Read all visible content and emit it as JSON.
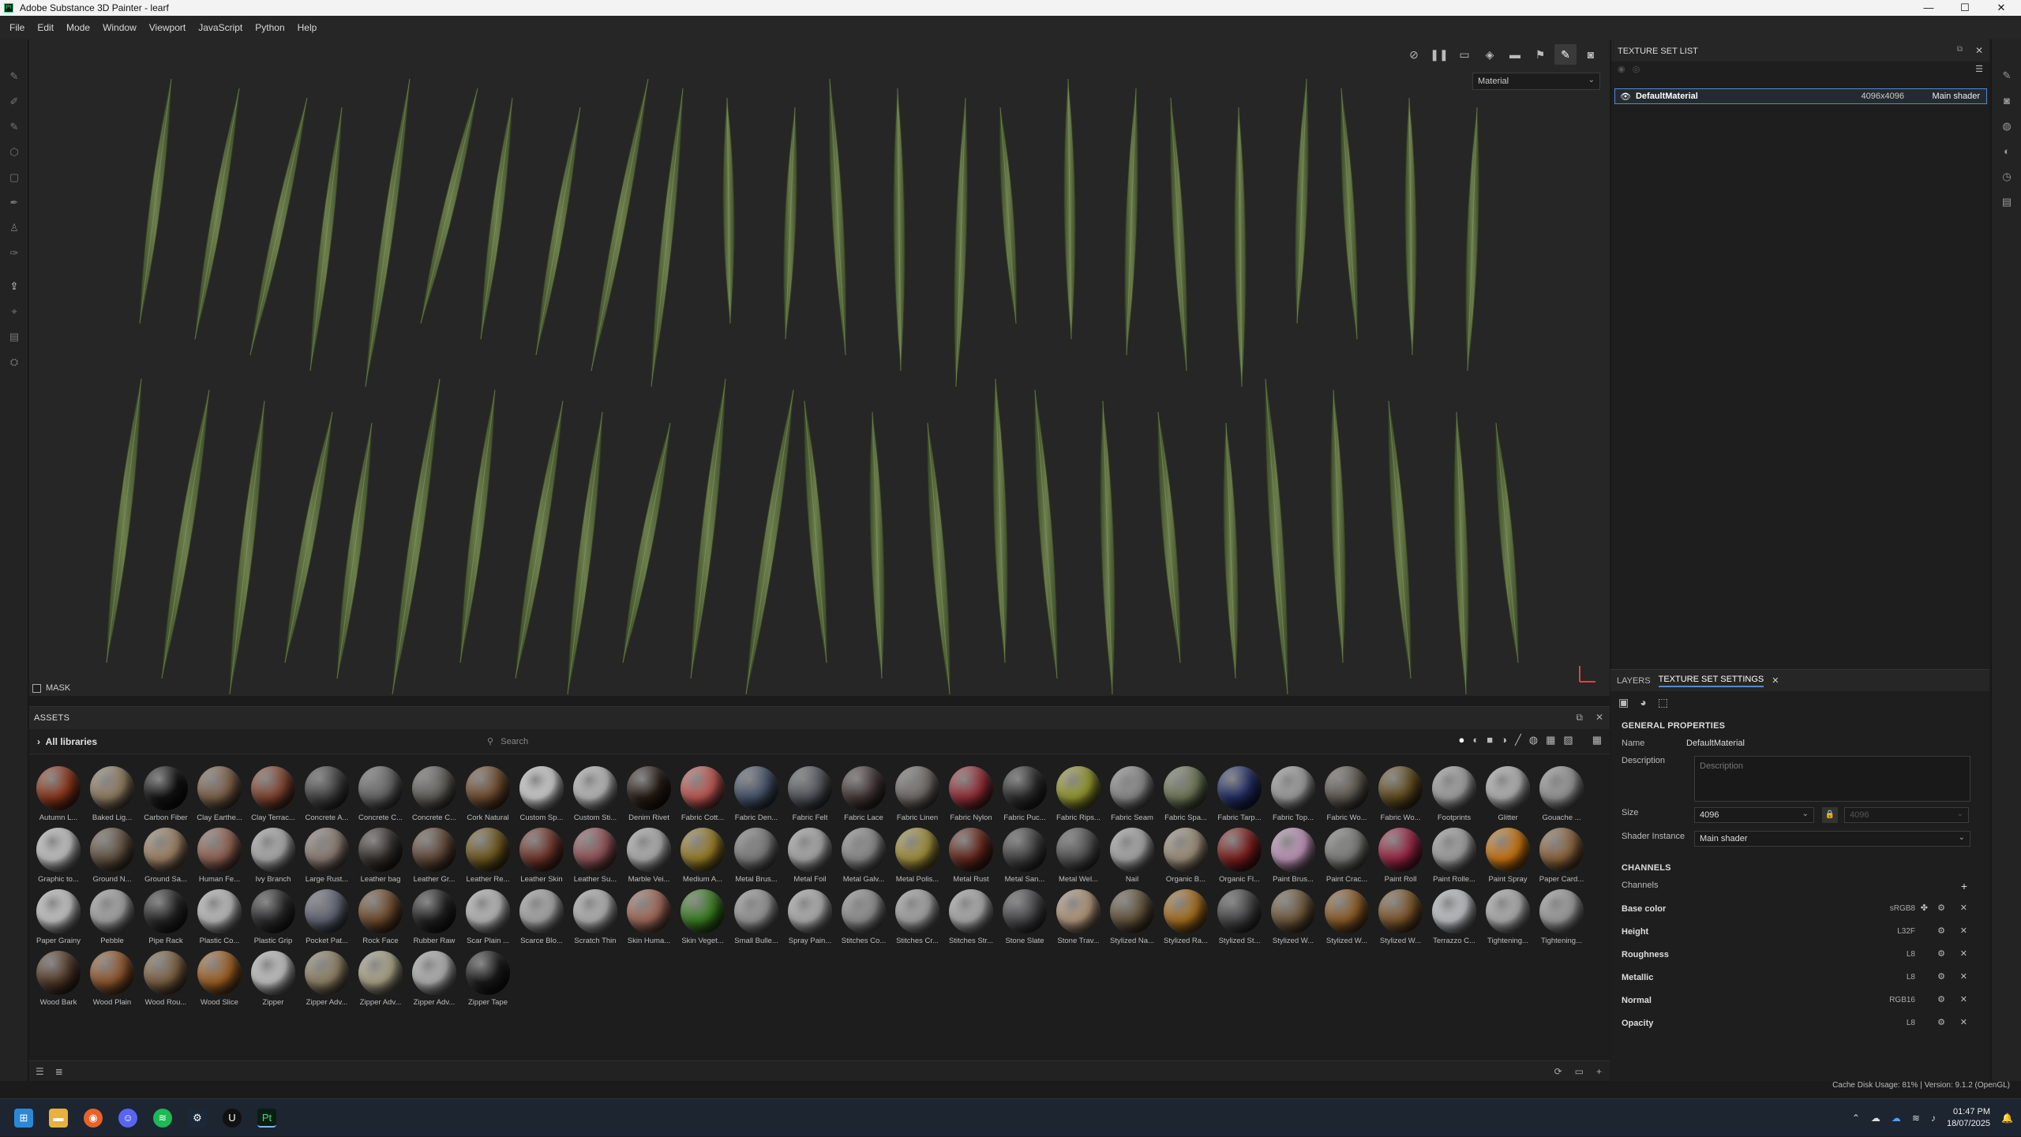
{
  "window": {
    "title": "Adobe Substance 3D Painter - learf",
    "minimize": "—",
    "maximize": "☐",
    "close": "✕"
  },
  "menu": [
    "File",
    "Edit",
    "Mode",
    "Window",
    "Viewport",
    "JavaScript",
    "Python",
    "Help"
  ],
  "viewport": {
    "material_select": "Material",
    "mask_label": "MASK"
  },
  "assets": {
    "title": "ASSETS",
    "libraries": "All libraries",
    "search_placeholder": "Search",
    "materials": [
      {
        "name": "Autumn L...",
        "color": "#9a3a1c"
      },
      {
        "name": "Baked Lig...",
        "color": "#a08a6c"
      },
      {
        "name": "Carbon Fiber",
        "color": "#151515"
      },
      {
        "name": "Clay Earthe...",
        "color": "#8a6a50"
      },
      {
        "name": "Clay Terrac...",
        "color": "#8e4a32"
      },
      {
        "name": "Concrete A...",
        "color": "#4a4a4c"
      },
      {
        "name": "Concrete C...",
        "color": "#707070"
      },
      {
        "name": "Concrete C...",
        "color": "#6a6862"
      },
      {
        "name": "Cork Natural",
        "color": "#7a5232"
      },
      {
        "name": "Custom Sp...",
        "color": "#e8e8e8"
      },
      {
        "name": "Custom Sti...",
        "color": "#d0d0d0"
      },
      {
        "name": "Denim Rivet",
        "color": "#2a1e18"
      },
      {
        "name": "Fabric Cott...",
        "color": "#d4605a"
      },
      {
        "name": "Fabric Den...",
        "color": "#4c5a74"
      },
      {
        "name": "Fabric Felt",
        "color": "#5a5e66"
      },
      {
        "name": "Fabric Lace",
        "color": "#4a3c3c"
      },
      {
        "name": "Fabric Linen",
        "color": "#7c7672"
      },
      {
        "name": "Fabric Nylon",
        "color": "#a3323c"
      },
      {
        "name": "Fabric Puc...",
        "color": "#303030"
      },
      {
        "name": "Fabric Rips...",
        "color": "#a4a832"
      },
      {
        "name": "Fabric Seam",
        "color": "#9a9a9a"
      },
      {
        "name": "Fabric Spa...",
        "color": "#7a8460"
      },
      {
        "name": "Fabric Tarp...",
        "color": "#24306e"
      },
      {
        "name": "Fabric Top...",
        "color": "#b0b0b0"
      },
      {
        "name": "Fabric Wo...",
        "color": "#6a625a"
      },
      {
        "name": "Fabric Wo...",
        "color": "#6a5220"
      },
      {
        "name": "Footprints",
        "color": "#b4b4b4"
      },
      {
        "name": "Glitter",
        "color": "#c8c8c8"
      },
      {
        "name": "Gouache ...",
        "color": "#a8a8a8"
      },
      {
        "name": "Graphic to...",
        "color": "#dcdcdc"
      },
      {
        "name": "Ground N...",
        "color": "#6c5a48"
      },
      {
        "name": "Ground Sa...",
        "color": "#b09070"
      },
      {
        "name": "Human Fe...",
        "color": "#a06c5c"
      },
      {
        "name": "Ivy Branch",
        "color": "#c0c0c0"
      },
      {
        "name": "Large Rust...",
        "color": "#9c8a80"
      },
      {
        "name": "Leather bag",
        "color": "#3a3430"
      },
      {
        "name": "Leather Gr...",
        "color": "#6a4e3e"
      },
      {
        "name": "Leather Re...",
        "color": "#7a6020"
      },
      {
        "name": "Leather Skin",
        "color": "#7a3a2e"
      },
      {
        "name": "Leather Su...",
        "color": "#a05a60"
      },
      {
        "name": "Marble Vei...",
        "color": "#c4c4c4"
      },
      {
        "name": "Medium A...",
        "color": "#a88a2a"
      },
      {
        "name": "Metal Brus...",
        "color": "#8a8a8a"
      },
      {
        "name": "Metal Foil",
        "color": "#bdbdbd"
      },
      {
        "name": "Metal Galv...",
        "color": "#9a9a9a"
      },
      {
        "name": "Metal Polis...",
        "color": "#b4a040"
      },
      {
        "name": "Metal Rust",
        "color": "#6e2a1e"
      },
      {
        "name": "Metal San...",
        "color": "#484848"
      },
      {
        "name": "Metal Wel...",
        "color": "#5a5a5a"
      },
      {
        "name": "Nail",
        "color": "#bcbcbc"
      },
      {
        "name": "Organic B...",
        "color": "#b0a088"
      },
      {
        "name": "Organic Fl...",
        "color": "#8a2020"
      },
      {
        "name": "Paint Brus...",
        "color": "#d6a6d0"
      },
      {
        "name": "Paint Crac...",
        "color": "#8a8a86"
      },
      {
        "name": "Paint Roll",
        "color": "#a8284a"
      },
      {
        "name": "Paint Rolle...",
        "color": "#b4b4b4"
      },
      {
        "name": "Paint Spray",
        "color": "#e08010"
      },
      {
        "name": "Paper Card...",
        "color": "#9a6e44"
      },
      {
        "name": "Paper Grainy",
        "color": "#dedede"
      },
      {
        "name": "Pebble",
        "color": "#b8b8b8"
      },
      {
        "name": "Pipe Rack",
        "color": "#2a2a2a"
      },
      {
        "name": "Plastic Co...",
        "color": "#d4d4d4"
      },
      {
        "name": "Plastic Grip",
        "color": "#2e2e30"
      },
      {
        "name": "Pocket Pat...",
        "color": "#6a6e80"
      },
      {
        "name": "Rock Face",
        "color": "#7a5230"
      },
      {
        "name": "Rubber Raw",
        "color": "#242424"
      },
      {
        "name": "Scar Plain ...",
        "color": "#d0d0d0"
      },
      {
        "name": "Scarce Blo...",
        "color": "#bcbcbc"
      },
      {
        "name": "Scratch Thin",
        "color": "#c8c8c8"
      },
      {
        "name": "Skin Huma...",
        "color": "#b47462"
      },
      {
        "name": "Skin Veget...",
        "color": "#3e8a22"
      },
      {
        "name": "Small Bulle...",
        "color": "#a8a8a8"
      },
      {
        "name": "Spray Pain...",
        "color": "#c4c4c4"
      },
      {
        "name": "Stitches Co...",
        "color": "#a0a0a0"
      },
      {
        "name": "Stitches Cr...",
        "color": "#b8b8b8"
      },
      {
        "name": "Stitches Str...",
        "color": "#c0c0c0"
      },
      {
        "name": "Stone Slate",
        "color": "#4e4e52"
      },
      {
        "name": "Stone Trav...",
        "color": "#c8a888"
      },
      {
        "name": "Stylized Na...",
        "color": "#6a5a40"
      },
      {
        "name": "Stylized Ra...",
        "color": "#b87a20"
      },
      {
        "name": "Stylized St...",
        "color": "#4c4c4e"
      },
      {
        "name": "Stylized W...",
        "color": "#7a6040"
      },
      {
        "name": "Stylized W...",
        "color": "#9a6428"
      },
      {
        "name": "Stylized W...",
        "color": "#8a5e2e"
      },
      {
        "name": "Terrazzo C...",
        "color": "#d8dce0"
      },
      {
        "name": "Tightening...",
        "color": "#c4c4c4"
      },
      {
        "name": "Tightening...",
        "color": "#b0b0b0"
      },
      {
        "name": "Wood Bark",
        "color": "#5a3e2c"
      },
      {
        "name": "Wood Plain",
        "color": "#a06030"
      },
      {
        "name": "Wood Rou...",
        "color": "#8a6a48"
      },
      {
        "name": "Wood Slice",
        "color": "#b06a26"
      },
      {
        "name": "Zipper",
        "color": "#dcdcdc"
      },
      {
        "name": "Zipper Adv...",
        "color": "#a09070"
      },
      {
        "name": "Zipper Adv...",
        "color": "#c0b898"
      },
      {
        "name": "Zipper Adv...",
        "color": "#c8c8c8"
      },
      {
        "name": "Zipper Tape",
        "color": "#1d1d1d"
      }
    ]
  },
  "texture_set_list": {
    "title": "TEXTURE SET LIST",
    "row": {
      "name": "DefaultMaterial",
      "size": "4096x4096",
      "shader": "Main shader"
    }
  },
  "properties": {
    "tab_layers": "LAYERS",
    "tab_settings": "TEXTURE SET SETTINGS",
    "general_title": "GENERAL PROPERTIES",
    "name_label": "Name",
    "name_value": "DefaultMaterial",
    "desc_label": "Description",
    "desc_placeholder": "Description",
    "size_label": "Size",
    "size_value": "4096",
    "size_value2": "4096",
    "shader_label": "Shader Instance",
    "shader_value": "Main shader",
    "channels_title": "CHANNELS",
    "channels_label": "Channels",
    "channels": [
      {
        "name": "Base color",
        "format": "sRGB8"
      },
      {
        "name": "Height",
        "format": "L32F"
      },
      {
        "name": "Roughness",
        "format": "L8"
      },
      {
        "name": "Metallic",
        "format": "L8"
      },
      {
        "name": "Normal",
        "format": "RGB16"
      },
      {
        "name": "Opacity",
        "format": "L8"
      }
    ]
  },
  "status": {
    "text": "Cache Disk Usage:  81% | Version: 9.1.2 (OpenGL)"
  },
  "taskbar": {
    "time": "01:47 PM",
    "date": "18/07/2025"
  }
}
